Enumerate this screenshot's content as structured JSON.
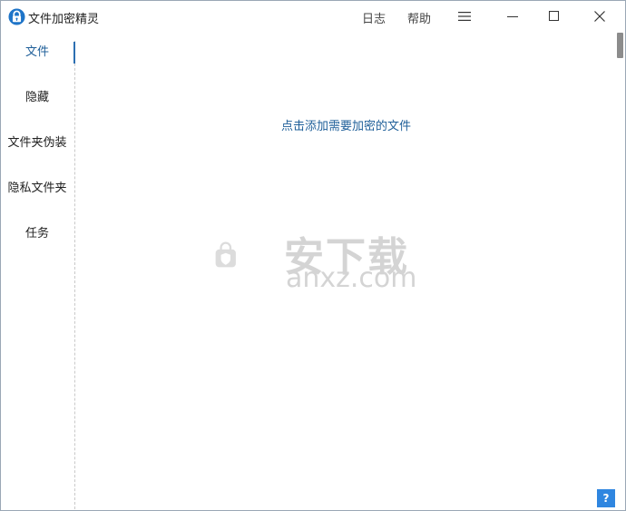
{
  "window": {
    "title": "文件加密精灵",
    "log_label": "日志",
    "help_label": "帮助"
  },
  "sidebar": {
    "items": [
      {
        "label": "文件",
        "active": true
      },
      {
        "label": "隐藏",
        "active": false
      },
      {
        "label": "文件夹伪装",
        "active": false
      },
      {
        "label": "隐私文件夹",
        "active": false
      },
      {
        "label": "任务",
        "active": false
      }
    ]
  },
  "main": {
    "add_link": "点击添加需要加密的文件"
  },
  "watermark": {
    "cn": "安下载",
    "en": "anxz.com"
  },
  "help_corner": "?",
  "colors": {
    "accent": "#1f5f99",
    "help_button": "#2f86e0"
  }
}
